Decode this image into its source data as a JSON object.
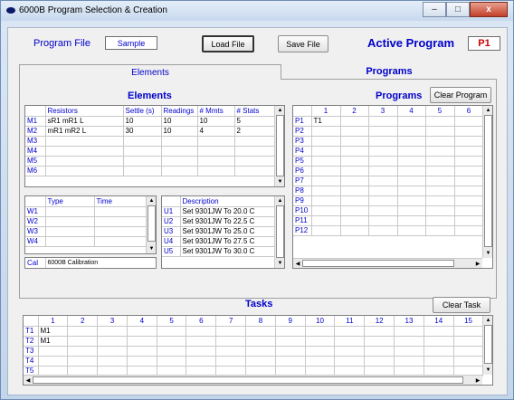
{
  "window": {
    "title": "6000B Program Selection & Creation",
    "min": "–",
    "max": "□",
    "close": "x"
  },
  "header": {
    "program_file_label": "Program File",
    "program_file_value": "Sample",
    "load_file": "Load File",
    "save_file": "Save File",
    "active_program_label": "Active Program",
    "active_program_value": "P1"
  },
  "tabs": [
    {
      "label": "Elements"
    },
    {
      "label": "Programs"
    }
  ],
  "elements": {
    "title": "Elements",
    "resistors": {
      "headers": [
        "",
        "Resistors",
        "Settle (s)",
        "Readings",
        "# Mmts",
        "# Stats"
      ],
      "rows": [
        [
          "M1",
          "sR1  mR1  L",
          "10",
          "10",
          "10",
          "5"
        ],
        [
          "M2",
          "mR1  mR2  L",
          "30",
          "10",
          "4",
          "2"
        ],
        [
          "M3",
          "",
          "",
          "",
          "",
          ""
        ],
        [
          "M4",
          "",
          "",
          "",
          "",
          ""
        ],
        [
          "M5",
          "",
          "",
          "",
          "",
          ""
        ],
        [
          "M6",
          "",
          "",
          "",
          "",
          ""
        ]
      ]
    },
    "waits": {
      "headers": [
        "",
        "Type",
        "Time"
      ],
      "rows": [
        [
          "W1",
          "",
          ""
        ],
        [
          "W2",
          "",
          ""
        ],
        [
          "W3",
          "",
          ""
        ],
        [
          "W4",
          "",
          ""
        ]
      ]
    },
    "cal": {
      "label": "Cal",
      "value": "6000B Calibration"
    },
    "users": {
      "headers": [
        "",
        "Description"
      ],
      "rows": [
        [
          "U1",
          "Set 9301JW To 20.0 C"
        ],
        [
          "U2",
          "Set 9301JW To 22.5 C"
        ],
        [
          "U3",
          "Set 9301JW To 25.0 C"
        ],
        [
          "U4",
          "Set 9301JW To 27.5 C"
        ],
        [
          "U5",
          "Set 9301JW To 30.0 C"
        ]
      ]
    }
  },
  "programs": {
    "title": "Programs",
    "clear_button": "Clear Program",
    "headers": [
      "",
      "1",
      "2",
      "3",
      "4",
      "5",
      "6"
    ],
    "rows": [
      [
        "P1",
        "T1",
        "",
        "",
        "",
        "",
        ""
      ],
      [
        "P2",
        "",
        "",
        "",
        "",
        "",
        ""
      ],
      [
        "P3",
        "",
        "",
        "",
        "",
        "",
        ""
      ],
      [
        "P4",
        "",
        "",
        "",
        "",
        "",
        ""
      ],
      [
        "P5",
        "",
        "",
        "",
        "",
        "",
        ""
      ],
      [
        "P6",
        "",
        "",
        "",
        "",
        "",
        ""
      ],
      [
        "P7",
        "",
        "",
        "",
        "",
        "",
        ""
      ],
      [
        "P8",
        "",
        "",
        "",
        "",
        "",
        ""
      ],
      [
        "P9",
        "",
        "",
        "",
        "",
        "",
        ""
      ],
      [
        "P10",
        "",
        "",
        "",
        "",
        "",
        ""
      ],
      [
        "P11",
        "",
        "",
        "",
        "",
        "",
        ""
      ],
      [
        "P12",
        "",
        "",
        "",
        "",
        "",
        ""
      ]
    ]
  },
  "tasks": {
    "title": "Tasks",
    "clear_button": "Clear Task",
    "headers": [
      "",
      "1",
      "2",
      "3",
      "4",
      "5",
      "6",
      "7",
      "8",
      "9",
      "10",
      "11",
      "12",
      "13",
      "14",
      "15"
    ],
    "rows": [
      [
        "T1",
        "M1",
        "",
        "",
        "",
        "",
        "",
        "",
        "",
        "",
        "",
        "",
        "",
        "",
        "",
        ""
      ],
      [
        "T2",
        "M1",
        "",
        "",
        "",
        "",
        "",
        "",
        "",
        "",
        "",
        "",
        "",
        "",
        "",
        ""
      ],
      [
        "T3",
        "",
        "",
        "",
        "",
        "",
        "",
        "",
        "",
        "",
        "",
        "",
        "",
        "",
        "",
        ""
      ],
      [
        "T4",
        "",
        "",
        "",
        "",
        "",
        "",
        "",
        "",
        "",
        "",
        "",
        "",
        "",
        "",
        ""
      ],
      [
        "T5",
        "",
        "",
        "",
        "",
        "",
        "",
        "",
        "",
        "",
        "",
        "",
        "",
        "",
        "",
        ""
      ]
    ]
  },
  "scroll_glyphs": {
    "up": "▲",
    "down": "▼",
    "left": "◀",
    "right": "▶"
  },
  "colors": {
    "accent_blue": "#0000cc",
    "active_program_text": "#cc0000"
  }
}
